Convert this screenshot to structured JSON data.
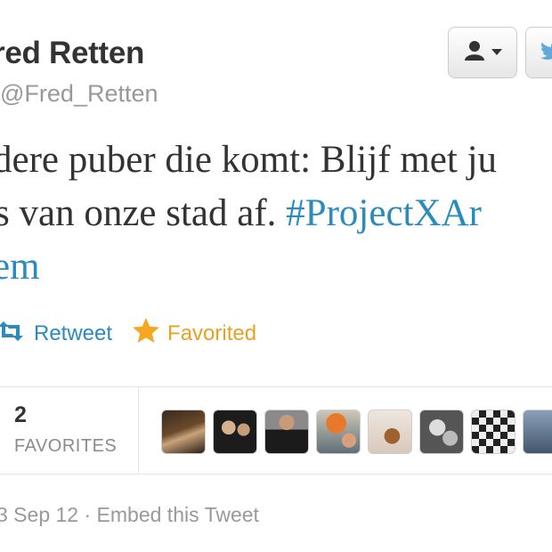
{
  "profile": {
    "name": "red Retten",
    "handle": "Fred_Retten"
  },
  "tweet": {
    "line1": "dere puber die komt: Blijf met ju",
    "line2_text": " van onze stad af. ",
    "line2_hashtag": "#ProjectXAr",
    "line3_hashtag": "em"
  },
  "actions": {
    "retweet_label": "Retweet",
    "favorite_label": "Favorited"
  },
  "stats": {
    "favorites_count": "2",
    "favorites_label": "FAVORITES"
  },
  "meta": {
    "date": "3 Sep 12",
    "separator": " · ",
    "embed_label": "Embed this Tweet"
  },
  "icons": {
    "user": "user-menu-icon",
    "bird": "twitter-bird-icon",
    "retweet": "retweet-icon",
    "star": "star-icon"
  },
  "colors": {
    "link": "#2b8bbd",
    "favorited": "#e8a123",
    "text": "#333333",
    "muted": "#999999"
  }
}
